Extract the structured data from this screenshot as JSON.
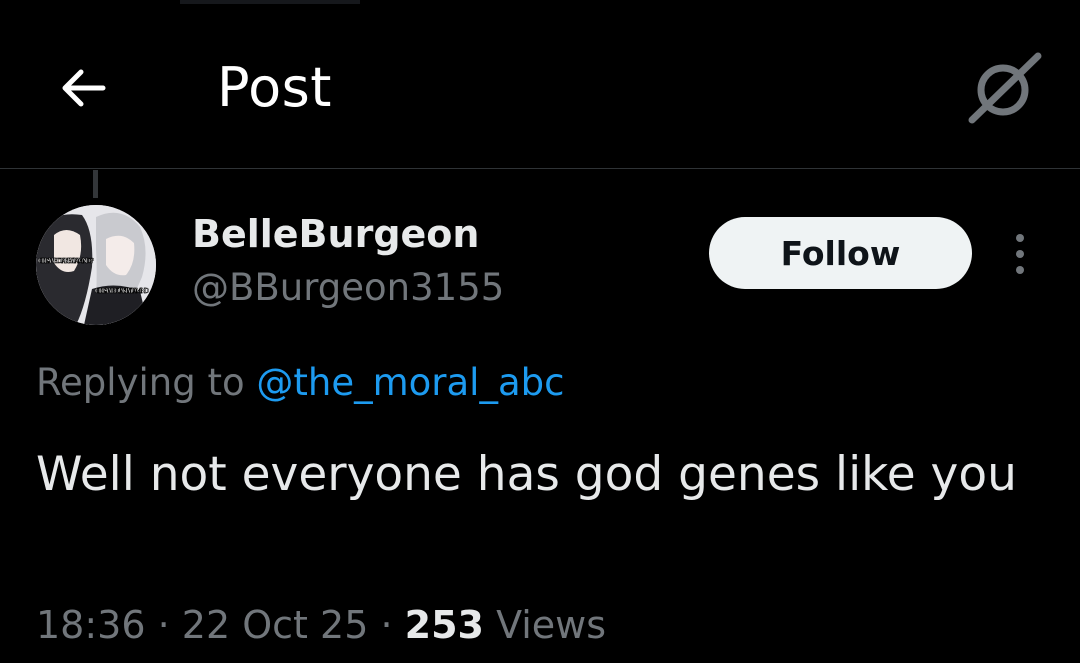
{
  "header": {
    "title": "Post",
    "back_icon": "arrow-left-icon",
    "grok_icon": "grok-icon"
  },
  "post": {
    "author": {
      "display_name": "BelleBurgeon",
      "handle": "@BBurgeon3155",
      "avatar_caption_top": "GIRLS WHO TAKE VITAMIN D3?",
      "avatar_caption_bottom": "GIRLS WHO TAKE VITAMIN D"
    },
    "follow_label": "Follow",
    "more_icon": "more-vertical-icon",
    "replying_prefix": "Replying to",
    "replying_handle": "@the_moral_abc",
    "text": "Well not everyone has god genes like you",
    "time": "18:36",
    "sep1": "·",
    "date": "22 Oct 25",
    "sep2": "·",
    "views_count": "253",
    "views_label": "Views"
  },
  "colors": {
    "background": "#000000",
    "text_primary": "#e7e9ea",
    "text_secondary": "#71767b",
    "link": "#1d9bf0",
    "follow_bg": "#eff3f4",
    "divider": "#2f3336"
  }
}
